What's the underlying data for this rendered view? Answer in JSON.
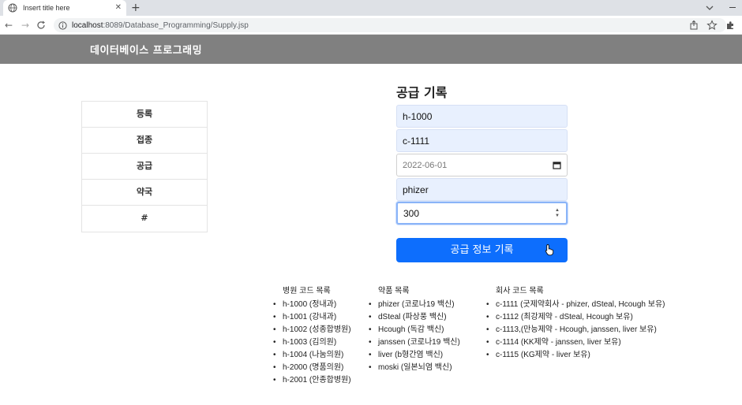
{
  "browser": {
    "tab_title": "Insert title here",
    "new_tab_symbol": "+",
    "close_symbol": "✕",
    "url_host": "localhost",
    "url_rest": ":8089/Database_Programming/Supply.jsp"
  },
  "header": {
    "brand": "데이터베이스 프로그래밍"
  },
  "menu": {
    "items": [
      {
        "label": "등록"
      },
      {
        "label": "접종"
      },
      {
        "label": "공급"
      },
      {
        "label": "약국"
      },
      {
        "label": "#"
      }
    ]
  },
  "form": {
    "title": "공급 기록",
    "hospital_code": "h-1000",
    "company_code": "c-1111",
    "date": "2022-06-01",
    "vaccine": "phizer",
    "quantity": "300",
    "submit_label": "공급 정보 기록"
  },
  "lists": {
    "hospitals": {
      "heading": "병원 코드 목록",
      "items": [
        "h-1000 (정내과)",
        "h-1001 (강내과)",
        "h-1002 (성종합병원)",
        "h-1003 (김의원)",
        "h-1004 (나눔의원)",
        "h-2000 (명품의원)",
        "h-2001 (안종합병원)"
      ]
    },
    "vaccines": {
      "heading": "약품 목록",
      "items": [
        "phizer (코로나19 백신)",
        "dSteal (파상풍 백신)",
        "Hcough (독감 백신)",
        "janssen (코로나19 백신)",
        "liver (b형간염 백신)",
        "moski (일본뇌염 백신)"
      ]
    },
    "companies": {
      "heading": "회사 코드 목록",
      "items": [
        "c-1111 (굿제약회사 - phizer, dSteal, Hcough 보유)",
        "c-1112 (최강제약 - dSteal, Hcough 보유)",
        "c-1113,(만능제약 - Hcough, janssen, liver 보유)",
        "c-1114 (KK제약 - janssen, liver 보유)",
        "c-1115 (KG제약 - liver 보유)"
      ]
    }
  },
  "colors": {
    "header_bg": "#808080",
    "button_bg": "#0d6efd",
    "autofill_bg": "#e8f0fe"
  }
}
